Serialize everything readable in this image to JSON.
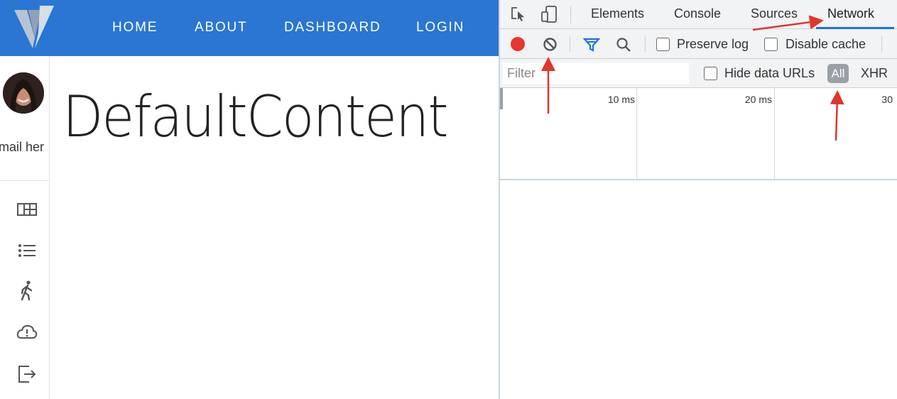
{
  "app": {
    "nav": [
      "HOME",
      "ABOUT",
      "DASHBOARD",
      "LOGIN"
    ],
    "sidebar": {
      "email_text": "mail her",
      "icons": [
        "grid-icon",
        "list-icon",
        "walk-icon",
        "cloud-alert-icon",
        "exit-icon"
      ]
    },
    "main_title": "DefaultContent"
  },
  "devtools": {
    "tabs": [
      "Elements",
      "Console",
      "Sources",
      "Network"
    ],
    "active_tab": "Network",
    "toolbar": {
      "preserve_log_label": "Preserve log",
      "disable_cache_label": "Disable cache"
    },
    "filter": {
      "placeholder": "Filter",
      "hide_data_urls_label": "Hide data URLs",
      "type_all": "All",
      "type_xhr": "XHR"
    },
    "timeline_ticks": [
      "10 ms",
      "20 ms",
      "30"
    ]
  },
  "colors": {
    "app_bar": "#2a76d2",
    "record": "#e8372c",
    "annotation_arrow": "#e0352b",
    "active_tab_underline": "#1a73e8"
  }
}
